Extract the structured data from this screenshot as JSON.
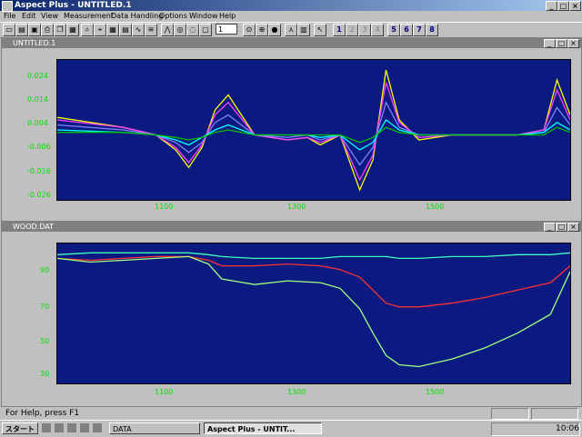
{
  "window": {
    "title": "Aspect Plus - UNTITLED.1",
    "controls": [
      "_",
      "□",
      "×"
    ]
  },
  "menu": [
    "File",
    "Edit",
    "View",
    "Measurement",
    "Data Handling",
    "Options",
    "Window",
    "Help"
  ],
  "toolbar": {
    "input_value": "1",
    "numbers": [
      "1",
      "2",
      "3",
      "4",
      "5",
      "6",
      "7",
      "8"
    ]
  },
  "plot1": {
    "title": "UNTITLED.1",
    "y_ticks": [
      "0.024",
      "0.014",
      "0.004",
      "-0.006",
      "-0.016",
      "-0.026"
    ],
    "x_ticks": [
      "1100",
      "1300",
      "1500"
    ]
  },
  "plot2": {
    "title": "WOOD.DAT",
    "y_ticks": [
      "90",
      "70",
      "50",
      "30"
    ],
    "x_ticks": [
      "1100",
      "1300",
      "1500"
    ]
  },
  "status": {
    "text": "For Help, press F1"
  },
  "taskbar": {
    "start": "スタート",
    "task1": "DATA",
    "task2": "Aspect Plus - UNTIT...",
    "clock": "10:06"
  },
  "colors": {
    "plot_bg": "#0a1a80",
    "axis_text": "#00e000",
    "title_active": "#0a246a"
  },
  "chart_data": [
    {
      "type": "line",
      "title": "UNTITLED.1",
      "x": [
        900,
        1000,
        1050,
        1080,
        1100,
        1120,
        1140,
        1160,
        1200,
        1250,
        1280,
        1300,
        1330,
        1360,
        1380,
        1400,
        1420,
        1450,
        1500,
        1550,
        1600,
        1640,
        1660,
        1680
      ],
      "ylim": [
        -0.026,
        0.03
      ],
      "series": [
        {
          "color": "#ffff00",
          "values": [
            0.007,
            0.003,
            0.0,
            -0.006,
            -0.013,
            -0.005,
            0.01,
            0.016,
            0.0,
            -0.002,
            -0.001,
            -0.004,
            0.0,
            -0.022,
            -0.01,
            0.026,
            0.006,
            -0.002,
            0.0,
            0.0,
            0.0,
            0.002,
            0.022,
            0.008
          ]
        },
        {
          "color": "#ff40ff",
          "values": [
            0.006,
            0.003,
            0.0,
            -0.005,
            -0.011,
            -0.004,
            0.008,
            0.013,
            0.0,
            -0.002,
            -0.001,
            -0.003,
            0.0,
            -0.018,
            -0.008,
            0.021,
            0.005,
            -0.001,
            0.0,
            0.0,
            0.0,
            0.002,
            0.018,
            0.006
          ]
        },
        {
          "color": "#8080ff",
          "values": [
            0.004,
            0.002,
            0.0,
            -0.003,
            -0.007,
            -0.003,
            0.005,
            0.008,
            0.0,
            -0.001,
            0.0,
            -0.002,
            0.0,
            -0.012,
            -0.005,
            0.013,
            0.003,
            0.0,
            0.0,
            0.0,
            0.0,
            0.001,
            0.011,
            0.004
          ]
        },
        {
          "color": "#00ffff",
          "values": [
            0.002,
            0.001,
            0.0,
            -0.002,
            -0.004,
            -0.001,
            0.002,
            0.004,
            0.0,
            0.0,
            0.0,
            -0.001,
            0.0,
            -0.006,
            -0.003,
            0.006,
            0.002,
            0.0,
            0.0,
            0.0,
            0.0,
            0.001,
            0.005,
            0.002
          ]
        },
        {
          "color": "#00c000",
          "values": [
            0.001,
            0.001,
            0.0,
            -0.001,
            -0.002,
            -0.001,
            0.001,
            0.002,
            0.0,
            0.0,
            0.0,
            0.0,
            0.0,
            -0.003,
            -0.001,
            0.003,
            0.001,
            0.0,
            0.0,
            0.0,
            0.0,
            0.0,
            0.003,
            0.001
          ]
        }
      ]
    },
    {
      "type": "line",
      "title": "WOOD.DAT",
      "x": [
        900,
        950,
        1000,
        1050,
        1100,
        1130,
        1150,
        1200,
        1250,
        1300,
        1330,
        1360,
        1380,
        1400,
        1420,
        1450,
        1500,
        1550,
        1600,
        1650,
        1680
      ],
      "ylim": [
        25,
        100
      ],
      "series": [
        {
          "color": "#40ffc0",
          "values": [
            94,
            95,
            95,
            95,
            95,
            94,
            93,
            92,
            92,
            92,
            93,
            93,
            93,
            93,
            92,
            92,
            93,
            93,
            94,
            94,
            95
          ]
        },
        {
          "color": "#ff3030",
          "values": [
            92,
            91,
            92,
            93,
            93,
            91,
            88,
            88,
            89,
            88,
            86,
            82,
            75,
            68,
            66,
            66,
            68,
            71,
            75,
            79,
            88
          ]
        },
        {
          "color": "#a0ff80",
          "values": [
            92,
            90,
            91,
            92,
            93,
            89,
            81,
            78,
            80,
            79,
            76,
            65,
            52,
            40,
            35,
            34,
            38,
            44,
            52,
            62,
            85
          ]
        }
      ]
    }
  ]
}
